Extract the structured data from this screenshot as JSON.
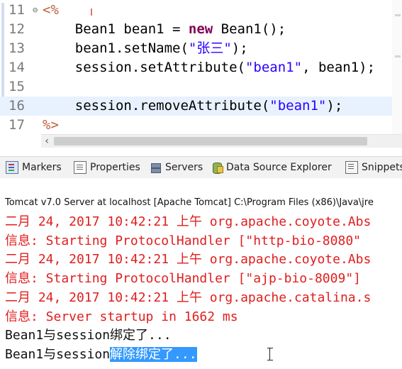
{
  "editor": {
    "lines": [
      {
        "num": "11",
        "fold": "⊖",
        "code": [
          {
            "t": "jsp",
            "v": "<%"
          }
        ]
      },
      {
        "num": "12",
        "fold": "",
        "code": [
          {
            "t": "plain",
            "v": "    Bean1 bean1 = "
          },
          {
            "t": "kw",
            "v": "new"
          },
          {
            "t": "plain",
            "v": " Bean1();"
          }
        ]
      },
      {
        "num": "13",
        "fold": "",
        "code": [
          {
            "t": "plain",
            "v": "    bean1.setName("
          },
          {
            "t": "str",
            "v": "\"张三\""
          },
          {
            "t": "plain",
            "v": ");"
          }
        ]
      },
      {
        "num": "14",
        "fold": "",
        "code": [
          {
            "t": "plain",
            "v": "    session.setAttribute("
          },
          {
            "t": "str",
            "v": "\"bean1\""
          },
          {
            "t": "plain",
            "v": ", bean1);"
          }
        ]
      },
      {
        "num": "15",
        "fold": "",
        "code": []
      },
      {
        "num": "16",
        "fold": "",
        "code": [
          {
            "t": "plain",
            "v": "    session.removeAttribute("
          },
          {
            "t": "str",
            "v": "\"bean1\""
          },
          {
            "t": "plain",
            "v": ");"
          }
        ]
      },
      {
        "num": "17",
        "fold": "",
        "code": [
          {
            "t": "jsp",
            "v": "%>"
          }
        ]
      }
    ],
    "current_line_index": 5,
    "scroll_left_arrow": "‹"
  },
  "views": {
    "tabs": [
      {
        "label": "Markers",
        "icon": "markers-icon"
      },
      {
        "label": "Properties",
        "icon": "properties-icon"
      },
      {
        "label": "Servers",
        "icon": "servers-icon"
      },
      {
        "label": "Data Source Explorer",
        "icon": "data-source-explorer-icon"
      },
      {
        "label": "Snippets",
        "icon": "snippets-icon"
      }
    ]
  },
  "console": {
    "title": "Tomcat v7.0 Server at localhost [Apache Tomcat] C:\\Program Files (x86)\\Java\\jre",
    "lines": [
      {
        "style": "err",
        "text": "二月 24, 2017 10:42:21 上午 org.apache.coyote.Abs"
      },
      {
        "style": "err",
        "text": "信息: Starting ProtocolHandler [\"http-bio-8080\""
      },
      {
        "style": "err",
        "text": "二月 24, 2017 10:42:21 上午 org.apache.coyote.Abs"
      },
      {
        "style": "err",
        "text": "信息: Starting ProtocolHandler [\"ajp-bio-8009\"]"
      },
      {
        "style": "err",
        "text": "二月 24, 2017 10:42:21 上午 org.apache.catalina.s"
      },
      {
        "style": "err",
        "text": "信息: Server startup in 1662 ms"
      },
      {
        "style": "out",
        "text": "Bean1与session绑定了..."
      },
      {
        "style": "out",
        "text": "Bean1与session",
        "selected": "解除绑定了..."
      }
    ]
  },
  "colors": {
    "keyword": "#7f0055",
    "string": "#2a00ff",
    "jsp_delimiter": "#bf5f3f",
    "console_error": "#e01e1e",
    "selection": "#3399ff",
    "current_line": "#e8f2fe"
  }
}
